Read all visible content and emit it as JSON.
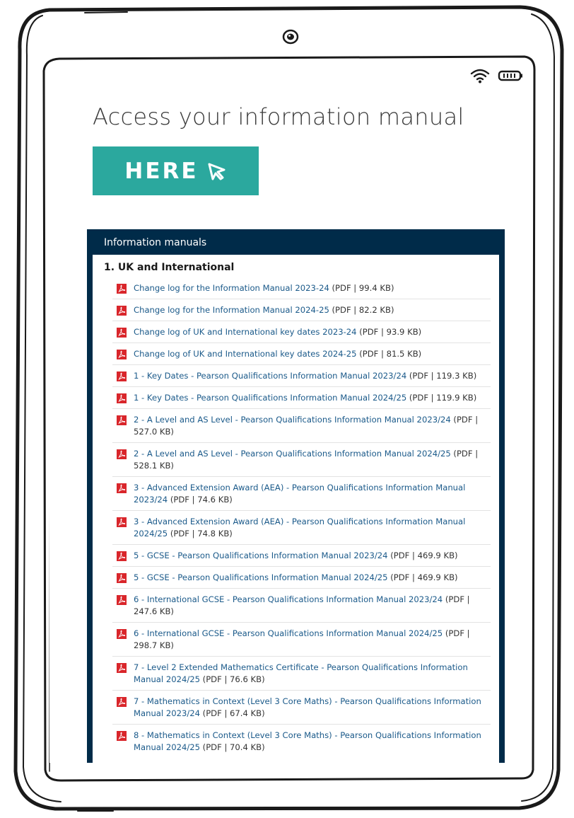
{
  "headline": "Access your information manual",
  "here_button": {
    "label": "HERE"
  },
  "panel": {
    "title": "Information manuals",
    "section_title": "1. UK and International",
    "documents": [
      {
        "title": "Change log for the Information Manual 2023-24",
        "meta": "(PDF | 99.4 KB)"
      },
      {
        "title": "Change log for the Information Manual 2024-25",
        "meta": "(PDF | 82.2 KB)"
      },
      {
        "title": "Change log of UK and International key dates 2023-24",
        "meta": "(PDF | 93.9 KB)"
      },
      {
        "title": "Change log of UK and International key dates 2024-25",
        "meta": "(PDF | 81.5 KB)"
      },
      {
        "title": "1 - Key Dates - Pearson Qualifications Information Manual 2023/24",
        "meta": "(PDF | 119.3 KB)"
      },
      {
        "title": "1 - Key Dates - Pearson Qualifications Information Manual 2024/25",
        "meta": "(PDF | 119.9 KB)"
      },
      {
        "title": "2 - A Level and AS Level - Pearson Qualifications Information Manual 2023/24",
        "meta": "(PDF | 527.0 KB)"
      },
      {
        "title": "2 - A Level and AS Level - Pearson Qualifications Information Manual 2024/25",
        "meta": "(PDF | 528.1 KB)"
      },
      {
        "title": "3 - Advanced Extension Award (AEA) - Pearson Qualifications Information Manual 2023/24",
        "meta": "(PDF | 74.6 KB)"
      },
      {
        "title": "3 - Advanced Extension Award (AEA) - Pearson Qualifications Information Manual 2024/25",
        "meta": "(PDF | 74.8 KB)"
      },
      {
        "title": "5 - GCSE - Pearson Qualifications Information Manual 2023/24",
        "meta": "(PDF | 469.9 KB)"
      },
      {
        "title": "5 - GCSE - Pearson Qualifications Information Manual 2024/25",
        "meta": "(PDF | 469.9 KB)"
      },
      {
        "title": "6 - International GCSE - Pearson Qualifications Information Manual 2023/24",
        "meta": "(PDF | 247.6 KB)"
      },
      {
        "title": "6 - International GCSE - Pearson Qualifications Information Manual 2024/25",
        "meta": "(PDF | 298.7 KB)"
      },
      {
        "title": "7 - Level 2 Extended Mathematics Certificate - Pearson Qualifications Information Manual 2024/25",
        "meta": "(PDF | 76.6 KB)"
      },
      {
        "title": "7 - Mathematics in Context (Level 3 Core Maths) - Pearson Qualifications Information Manual 2023/24",
        "meta": "(PDF | 67.4 KB)"
      },
      {
        "title": "8 - Mathematics in Context (Level 3 Core Maths) - Pearson Qualifications Information Manual 2024/25",
        "meta": "(PDF | 70.4 KB)"
      }
    ]
  },
  "icons": {
    "camera": "camera-icon",
    "wifi": "wifi-icon",
    "battery": "battery-icon",
    "cursor": "cursor-arrow-icon",
    "pdf": "pdf-icon"
  },
  "colors": {
    "accent": "#2ba89e",
    "panel_header": "#002b49",
    "link": "#1b5a8a",
    "pdf_red": "#d9262b",
    "frame": "#1a1a1a"
  }
}
